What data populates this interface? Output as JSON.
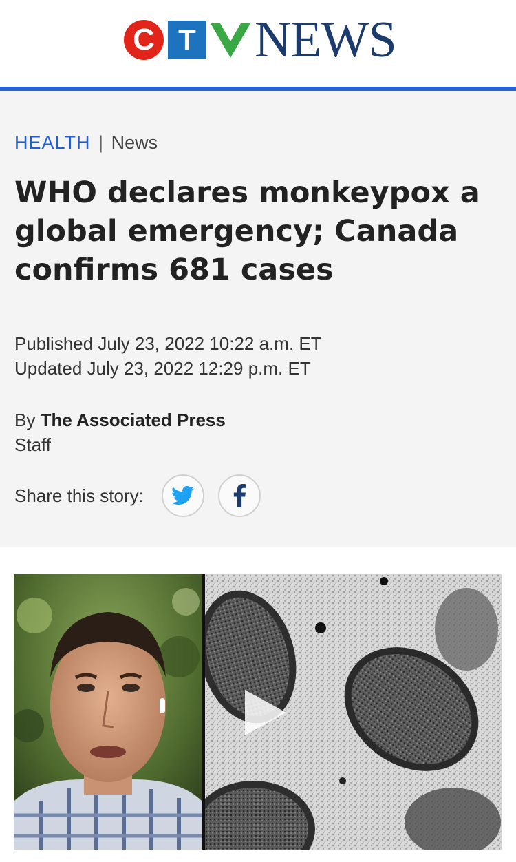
{
  "brand": {
    "logo_c": "C",
    "logo_t": "T",
    "logo_news": "NEWS",
    "accent_red": "#e1251b",
    "accent_blue": "#1e73be",
    "rule_blue": "#2b62d4"
  },
  "article": {
    "section": "HEALTH",
    "separator": "|",
    "subsection": "News",
    "headline": "WHO declares monkeypox a global emergency; Canada confirms 681 cases",
    "published": "Published July 23, 2022 10:22 a.m. ET",
    "updated": "Updated July 23, 2022 12:29 p.m. ET",
    "by_prefix": "By",
    "author": "The Associated Press",
    "author_role": "Staff"
  },
  "share": {
    "label": "Share this story:",
    "buttons": [
      {
        "name": "twitter",
        "icon": "twitter-bird-icon",
        "color": "#1da1f2"
      },
      {
        "name": "facebook",
        "icon": "facebook-f-icon",
        "color": "#1b3c6c"
      }
    ]
  },
  "video": {
    "left_panel": "man-speaking-thumbnail",
    "right_panel": "monkeypox-virus-micrograph",
    "play_icon": "play-icon"
  }
}
